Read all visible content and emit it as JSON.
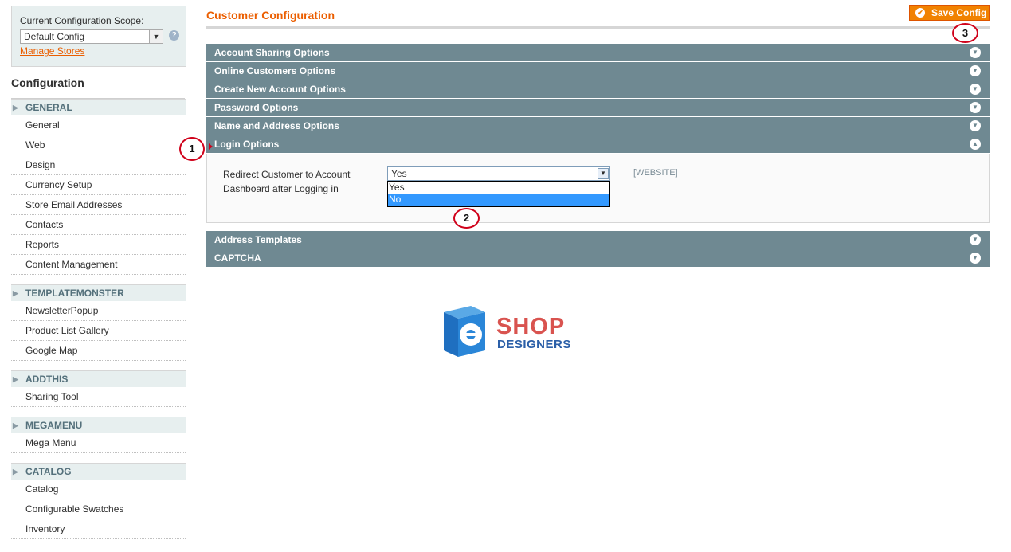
{
  "sidebar": {
    "scope_label": "Current Configuration Scope:",
    "scope_value": "Default Config",
    "help_glyph": "?",
    "manage_stores": "Manage Stores",
    "config_title": "Configuration",
    "groups": [
      {
        "title": "GENERAL",
        "items": [
          "General",
          "Web",
          "Design",
          "Currency Setup",
          "Store Email Addresses",
          "Contacts",
          "Reports",
          "Content Management"
        ]
      },
      {
        "title": "TEMPLATEMONSTER",
        "items": [
          "NewsletterPopup",
          "Product List Gallery",
          "Google Map"
        ]
      },
      {
        "title": "ADDTHIS",
        "items": [
          "Sharing Tool"
        ]
      },
      {
        "title": "MEGAMENU",
        "items": [
          "Mega Menu"
        ]
      },
      {
        "title": "CATALOG",
        "items": [
          "Catalog",
          "Configurable Swatches",
          "Inventory"
        ]
      }
    ]
  },
  "main": {
    "title": "Customer Configuration",
    "save_label": "Save Config",
    "sections": [
      "Account Sharing Options",
      "Online Customers Options",
      "Create New Account Options",
      "Password Options",
      "Name and Address Options",
      "Login Options",
      "Address Templates",
      "CAPTCHA"
    ],
    "login": {
      "field_label": "Redirect Customer to Account Dashboard after Logging in",
      "selected": "Yes",
      "options": [
        "Yes",
        "No"
      ],
      "scope": "[WEBSITE]"
    }
  },
  "callouts": [
    "1",
    "2",
    "3"
  ],
  "logo": {
    "line1": "SHOP",
    "line2": "DESIGNERS"
  },
  "colors": {
    "accent": "#eb5e00",
    "section_bar": "#6f8992",
    "button": "#f18200",
    "callout": "#d0021b"
  }
}
